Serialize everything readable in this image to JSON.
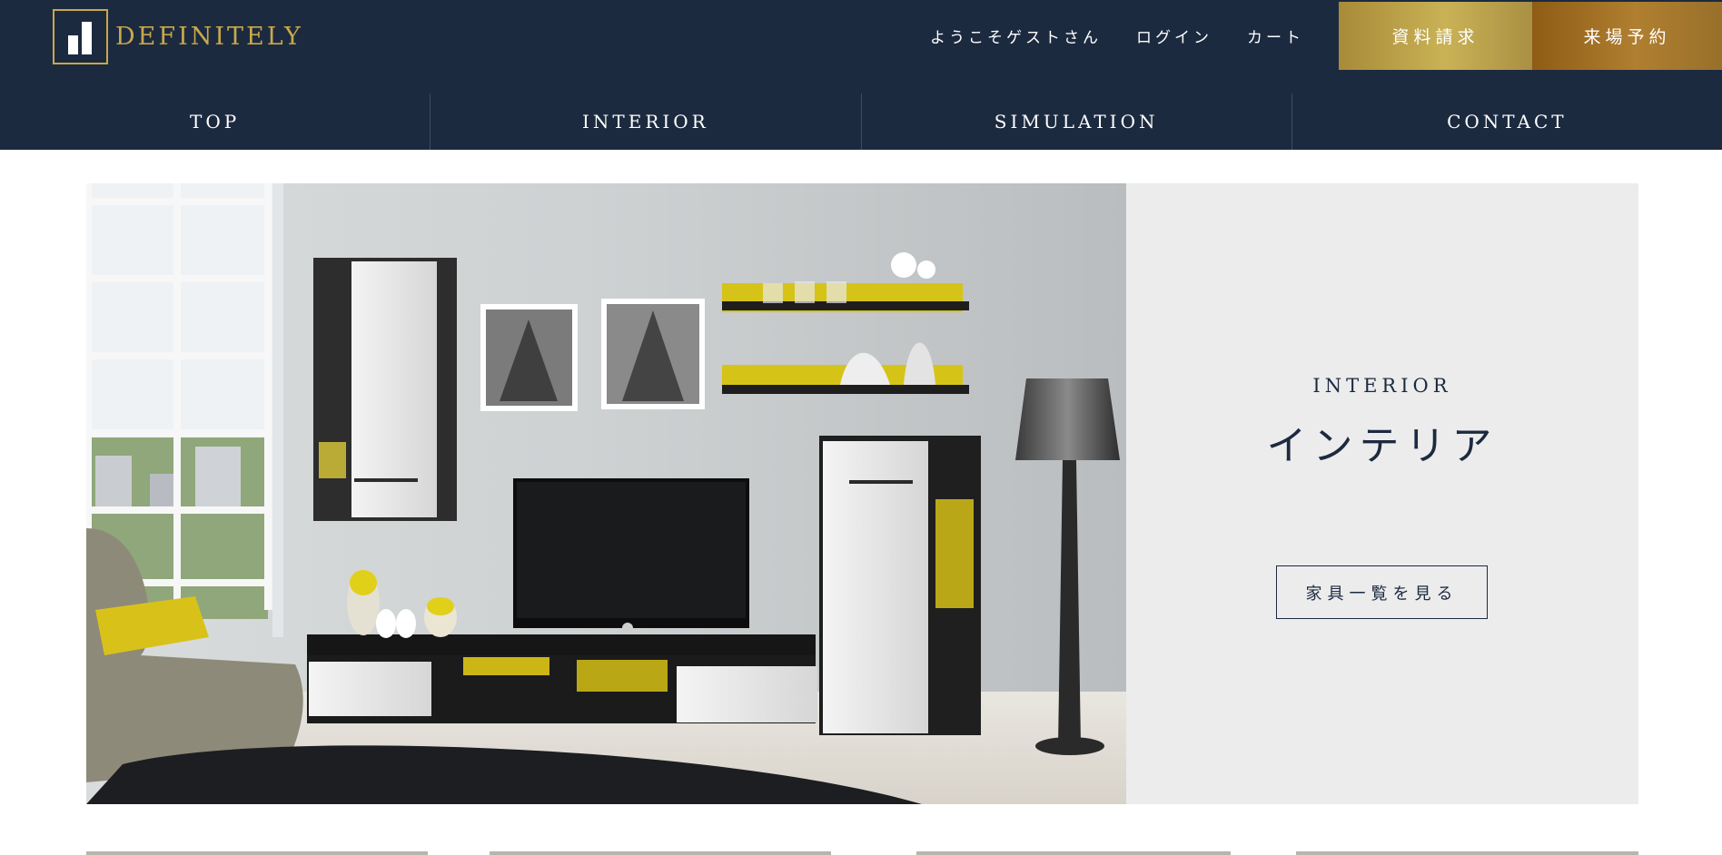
{
  "header": {
    "logo_text": "DEFINITELY",
    "welcome": "ようこそゲストさん",
    "login": "ログイン",
    "cart": "カート",
    "request_docs": "資料請求",
    "visit_booking": "来場予約"
  },
  "nav": {
    "items": [
      {
        "label": "TOP"
      },
      {
        "label": "INTERIOR"
      },
      {
        "label": "SIMULATION"
      },
      {
        "label": "CONTACT"
      }
    ]
  },
  "hero": {
    "panel_en": "INTERIOR",
    "panel_ja": "インテリア",
    "button": "家具一覧を見る"
  },
  "colors": {
    "navy": "#1c2a40",
    "gold": "#c8a84a",
    "gold_button": "#b39a47",
    "bronze_button": "#9c6b22",
    "panel_gray": "#ececec"
  }
}
